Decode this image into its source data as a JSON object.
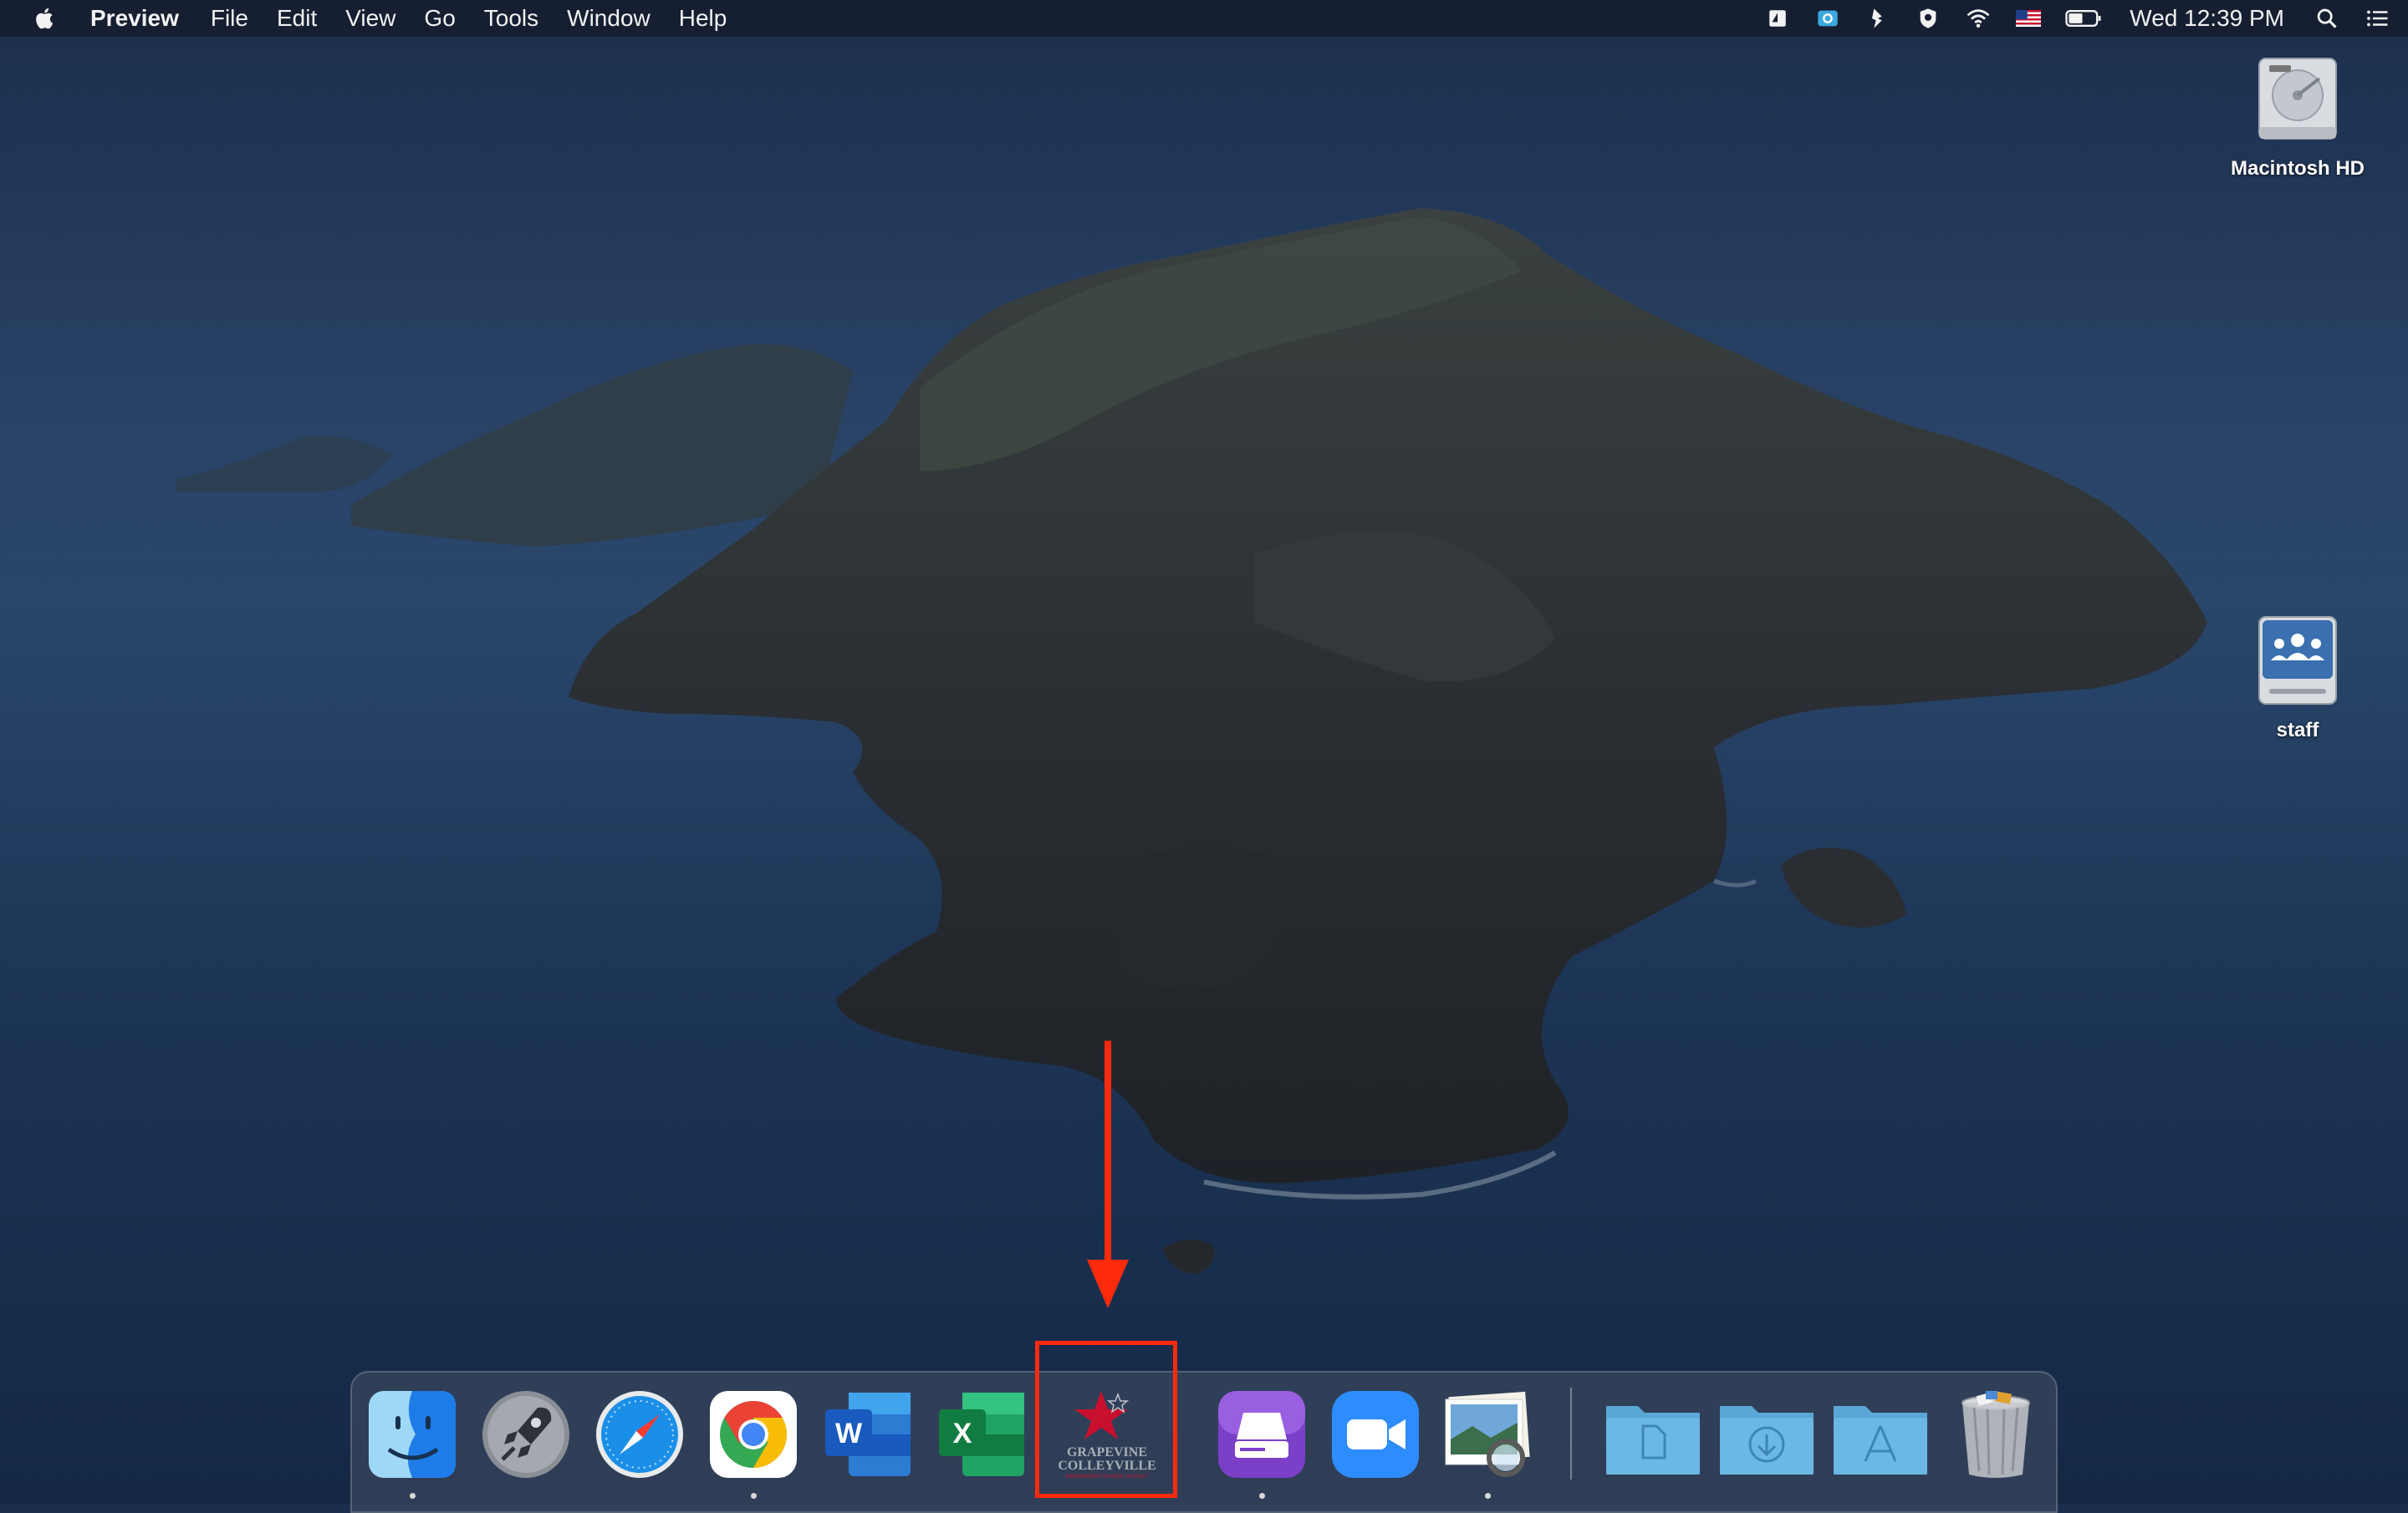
{
  "menubar": {
    "app_name": "Preview",
    "menus": [
      "File",
      "Edit",
      "View",
      "Go",
      "Tools",
      "Window",
      "Help"
    ],
    "clock": "Wed 12:39 PM",
    "status_icons": [
      "screen-share-icon",
      "screenshot-icon",
      "pen-tool-icon",
      "shield-icon",
      "wifi-icon",
      "us-flag-icon",
      "battery-icon"
    ],
    "search_icon": "spotlight-search-icon",
    "notification_icon": "notification-center-icon"
  },
  "desktop": {
    "icons": [
      {
        "label": "Macintosh HD",
        "icon": "hard-drive-icon"
      },
      {
        "label": "staff",
        "icon": "network-share-icon"
      }
    ]
  },
  "dock": {
    "apps": [
      {
        "icon": "finder-icon",
        "running": true
      },
      {
        "icon": "launchpad-icon",
        "running": false
      },
      {
        "icon": "safari-icon",
        "running": false
      },
      {
        "icon": "chrome-icon",
        "running": true
      },
      {
        "icon": "word-icon",
        "running": false
      },
      {
        "icon": "excel-icon",
        "running": false
      },
      {
        "icon": "gcisd-icon",
        "running": false,
        "logo_text": [
          "GRAPEVINE",
          "COLLEYVILLE",
          "INDEPENDENT SCHOOL DISTRICT"
        ]
      },
      {
        "icon": "disk-utility-icon",
        "running": true
      },
      {
        "icon": "zoom-icon",
        "running": false
      },
      {
        "icon": "preview-icon",
        "running": true
      },
      {
        "icon": "documents-folder-icon",
        "running": false
      },
      {
        "icon": "downloads-folder-icon",
        "running": false
      },
      {
        "icon": "applications-folder-icon",
        "running": false
      },
      {
        "icon": "trash-icon",
        "running": false
      }
    ]
  },
  "colors": {
    "annotation": "#ff2a0a",
    "menubar_bg": "#161e30",
    "sea": "#1d3556"
  }
}
